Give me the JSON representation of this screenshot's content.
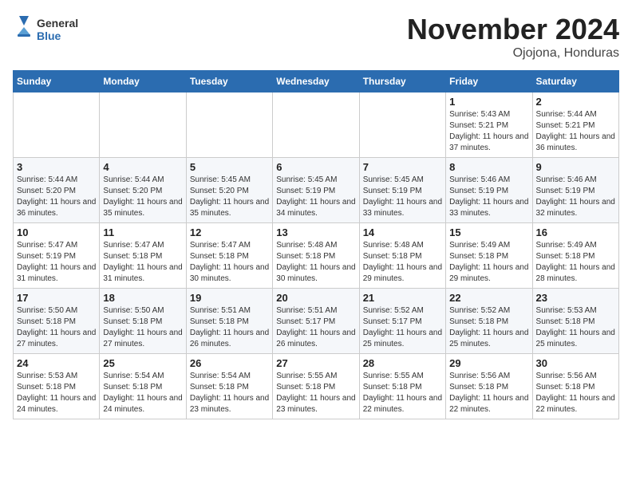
{
  "header": {
    "logo_general": "General",
    "logo_blue": "Blue",
    "month_title": "November 2024",
    "location": "Ojojona, Honduras"
  },
  "weekdays": [
    "Sunday",
    "Monday",
    "Tuesday",
    "Wednesday",
    "Thursday",
    "Friday",
    "Saturday"
  ],
  "weeks": [
    [
      {
        "day": "",
        "info": ""
      },
      {
        "day": "",
        "info": ""
      },
      {
        "day": "",
        "info": ""
      },
      {
        "day": "",
        "info": ""
      },
      {
        "day": "",
        "info": ""
      },
      {
        "day": "1",
        "info": "Sunrise: 5:43 AM\nSunset: 5:21 PM\nDaylight: 11 hours and 37 minutes."
      },
      {
        "day": "2",
        "info": "Sunrise: 5:44 AM\nSunset: 5:21 PM\nDaylight: 11 hours and 36 minutes."
      }
    ],
    [
      {
        "day": "3",
        "info": "Sunrise: 5:44 AM\nSunset: 5:20 PM\nDaylight: 11 hours and 36 minutes."
      },
      {
        "day": "4",
        "info": "Sunrise: 5:44 AM\nSunset: 5:20 PM\nDaylight: 11 hours and 35 minutes."
      },
      {
        "day": "5",
        "info": "Sunrise: 5:45 AM\nSunset: 5:20 PM\nDaylight: 11 hours and 35 minutes."
      },
      {
        "day": "6",
        "info": "Sunrise: 5:45 AM\nSunset: 5:19 PM\nDaylight: 11 hours and 34 minutes."
      },
      {
        "day": "7",
        "info": "Sunrise: 5:45 AM\nSunset: 5:19 PM\nDaylight: 11 hours and 33 minutes."
      },
      {
        "day": "8",
        "info": "Sunrise: 5:46 AM\nSunset: 5:19 PM\nDaylight: 11 hours and 33 minutes."
      },
      {
        "day": "9",
        "info": "Sunrise: 5:46 AM\nSunset: 5:19 PM\nDaylight: 11 hours and 32 minutes."
      }
    ],
    [
      {
        "day": "10",
        "info": "Sunrise: 5:47 AM\nSunset: 5:19 PM\nDaylight: 11 hours and 31 minutes."
      },
      {
        "day": "11",
        "info": "Sunrise: 5:47 AM\nSunset: 5:18 PM\nDaylight: 11 hours and 31 minutes."
      },
      {
        "day": "12",
        "info": "Sunrise: 5:47 AM\nSunset: 5:18 PM\nDaylight: 11 hours and 30 minutes."
      },
      {
        "day": "13",
        "info": "Sunrise: 5:48 AM\nSunset: 5:18 PM\nDaylight: 11 hours and 30 minutes."
      },
      {
        "day": "14",
        "info": "Sunrise: 5:48 AM\nSunset: 5:18 PM\nDaylight: 11 hours and 29 minutes."
      },
      {
        "day": "15",
        "info": "Sunrise: 5:49 AM\nSunset: 5:18 PM\nDaylight: 11 hours and 29 minutes."
      },
      {
        "day": "16",
        "info": "Sunrise: 5:49 AM\nSunset: 5:18 PM\nDaylight: 11 hours and 28 minutes."
      }
    ],
    [
      {
        "day": "17",
        "info": "Sunrise: 5:50 AM\nSunset: 5:18 PM\nDaylight: 11 hours and 27 minutes."
      },
      {
        "day": "18",
        "info": "Sunrise: 5:50 AM\nSunset: 5:18 PM\nDaylight: 11 hours and 27 minutes."
      },
      {
        "day": "19",
        "info": "Sunrise: 5:51 AM\nSunset: 5:18 PM\nDaylight: 11 hours and 26 minutes."
      },
      {
        "day": "20",
        "info": "Sunrise: 5:51 AM\nSunset: 5:17 PM\nDaylight: 11 hours and 26 minutes."
      },
      {
        "day": "21",
        "info": "Sunrise: 5:52 AM\nSunset: 5:17 PM\nDaylight: 11 hours and 25 minutes."
      },
      {
        "day": "22",
        "info": "Sunrise: 5:52 AM\nSunset: 5:18 PM\nDaylight: 11 hours and 25 minutes."
      },
      {
        "day": "23",
        "info": "Sunrise: 5:53 AM\nSunset: 5:18 PM\nDaylight: 11 hours and 25 minutes."
      }
    ],
    [
      {
        "day": "24",
        "info": "Sunrise: 5:53 AM\nSunset: 5:18 PM\nDaylight: 11 hours and 24 minutes."
      },
      {
        "day": "25",
        "info": "Sunrise: 5:54 AM\nSunset: 5:18 PM\nDaylight: 11 hours and 24 minutes."
      },
      {
        "day": "26",
        "info": "Sunrise: 5:54 AM\nSunset: 5:18 PM\nDaylight: 11 hours and 23 minutes."
      },
      {
        "day": "27",
        "info": "Sunrise: 5:55 AM\nSunset: 5:18 PM\nDaylight: 11 hours and 23 minutes."
      },
      {
        "day": "28",
        "info": "Sunrise: 5:55 AM\nSunset: 5:18 PM\nDaylight: 11 hours and 22 minutes."
      },
      {
        "day": "29",
        "info": "Sunrise: 5:56 AM\nSunset: 5:18 PM\nDaylight: 11 hours and 22 minutes."
      },
      {
        "day": "30",
        "info": "Sunrise: 5:56 AM\nSunset: 5:18 PM\nDaylight: 11 hours and 22 minutes."
      }
    ]
  ]
}
